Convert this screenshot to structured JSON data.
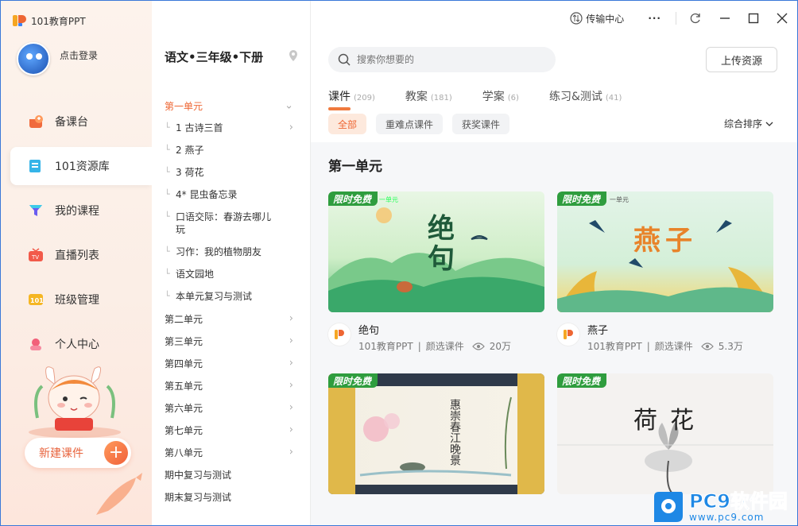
{
  "app": {
    "brand": "101教育PPT"
  },
  "user": {
    "login_label": "点击登录"
  },
  "nav": [
    {
      "label": "备课台",
      "icon": "prep-desk-icon"
    },
    {
      "label": "101资源库",
      "icon": "resource-library-icon"
    },
    {
      "label": "我的课程",
      "icon": "my-course-icon"
    },
    {
      "label": "直播列表",
      "icon": "live-tv-icon"
    },
    {
      "label": "班级管理",
      "icon": "class-manage-icon"
    },
    {
      "label": "个人中心",
      "icon": "personal-center-icon"
    }
  ],
  "new_course_label": "新建课件",
  "toolbar": {
    "transfer_label": "传输中心",
    "more": "···"
  },
  "book_title": "语文•三年级•下册",
  "toc": {
    "unit1": "第一单元",
    "lessons": [
      "1 古诗三首",
      "2 燕子",
      "3 荷花",
      "4* 昆虫备忘录",
      "口语交际：春游去哪儿玩",
      "习作：我的植物朋友",
      "语文园地",
      "本单元复习与测试"
    ],
    "units": [
      "第二单元",
      "第三单元",
      "第四单元",
      "第五单元",
      "第六单元",
      "第七单元",
      "第八单元"
    ],
    "extras": [
      "期中复习与测试",
      "期末复习与测试"
    ]
  },
  "search": {
    "placeholder": "搜索你想要的"
  },
  "upload_label": "上传资源",
  "tabs": [
    {
      "label": "课件",
      "count": "(209)"
    },
    {
      "label": "教案",
      "count": "(181)"
    },
    {
      "label": "学案",
      "count": "(6)"
    },
    {
      "label": "练习&测试",
      "count": "(41)"
    }
  ],
  "filters": [
    "全部",
    "重难点课件",
    "获奖课件"
  ],
  "sort_label": "综合排序",
  "section_title": "第一单元",
  "badge": "限时免费",
  "cards": [
    {
      "title": "绝句",
      "source": "101教育PPT",
      "type": "颜选课件",
      "views": "20万",
      "cover_text": "绝句",
      "cover_sub": "一单元"
    },
    {
      "title": "燕子",
      "source": "101教育PPT",
      "type": "颜选课件",
      "views": "5.3万",
      "cover_text": "燕子",
      "cover_sub": "一单元"
    },
    {
      "title": "惠崇春江晚景",
      "cover_text": "惠崇春江晚景"
    },
    {
      "title": "荷花",
      "cover_text": "荷花"
    }
  ],
  "watermark": {
    "text": "PC9软件园",
    "url": "www.pc9.com"
  },
  "colors": {
    "accent": "#ee6633",
    "badge_green": "#2f9d3e"
  }
}
